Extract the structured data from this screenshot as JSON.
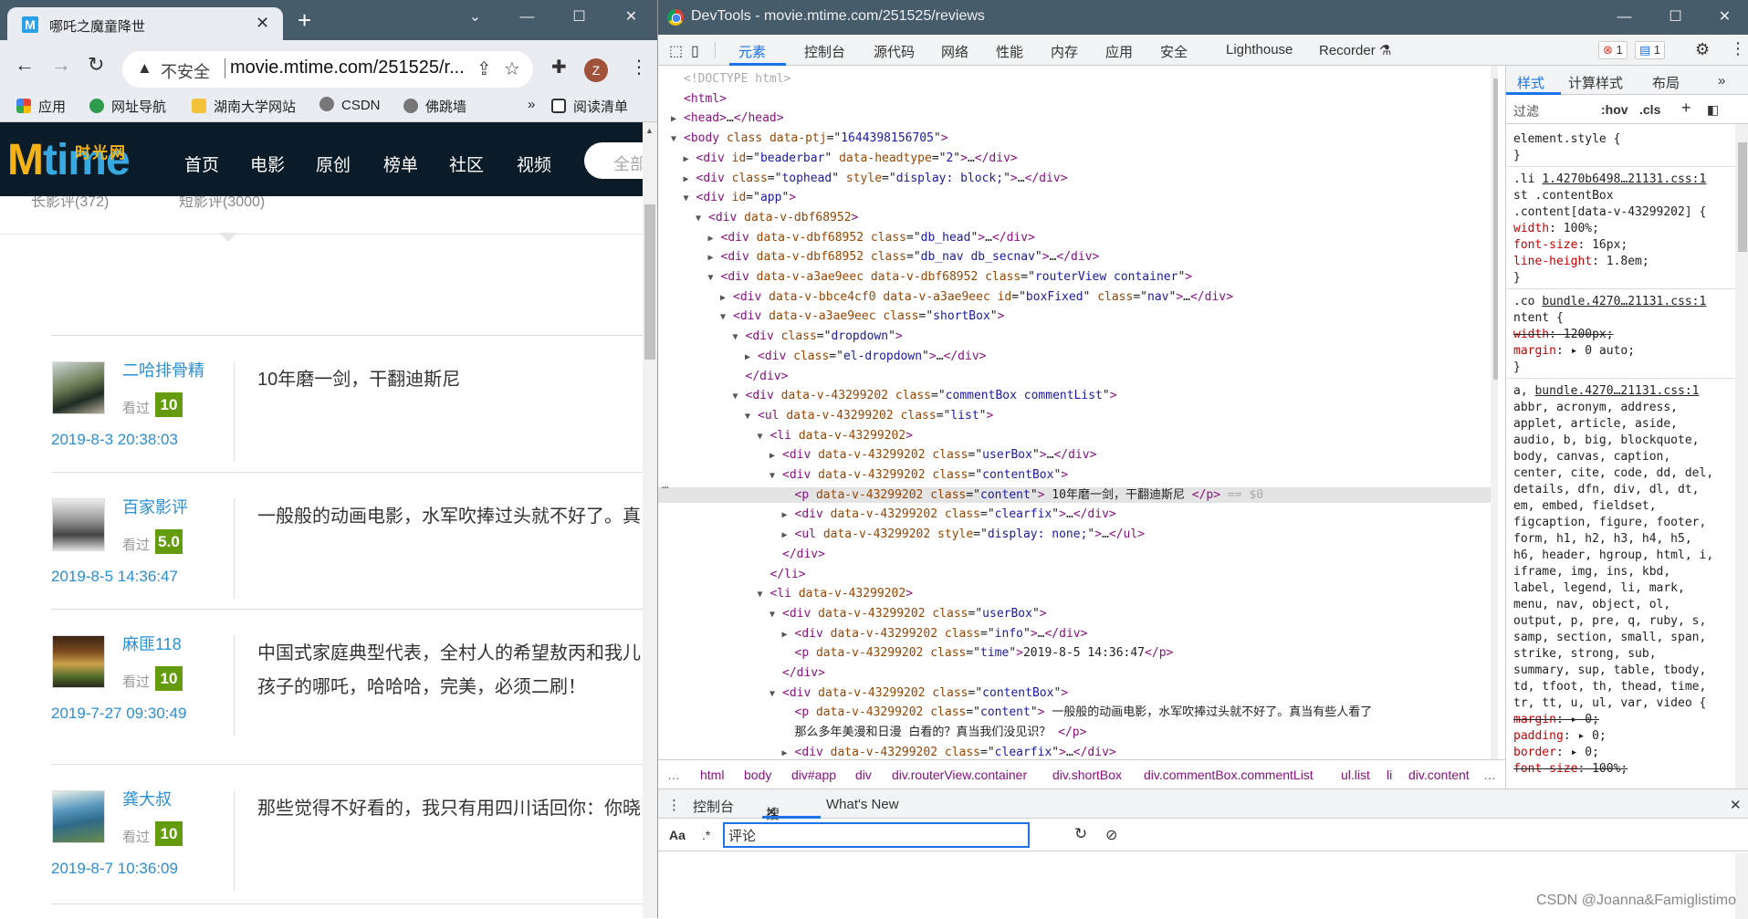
{
  "browser": {
    "tab_title": "哪吒之魔童降世",
    "favicon_letter": "M",
    "insecure_label": "不安全",
    "url": "movie.mtime.com/251525/r...",
    "profile_initial": "Z",
    "bookmarks": [
      "应用",
      "网址导航",
      "湖南大学网站",
      "CSDN",
      "佛跳墙",
      "阅读清单"
    ],
    "more_bookmarks": "»"
  },
  "site": {
    "logo_text": "Mtime",
    "logo_sub": "时光网",
    "nav": [
      "首页",
      "电影",
      "原创",
      "榜单",
      "社区",
      "视频"
    ],
    "search_placeholder": "全部",
    "subtabs": [
      "长影评(372)",
      "短影评(3000)"
    ],
    "reviews": [
      {
        "user": "二哈排骨精",
        "seen_label": "看过",
        "score": "10",
        "date": "2019-8-3 20:38:03",
        "content": "10年磨一剑，干翻迪斯尼",
        "content2": ""
      },
      {
        "user": "百家影评",
        "seen_label": "看过",
        "score": "5.0",
        "date": "2019-8-5 14:36:47",
        "content": "一般般的动画电影，水军吹捧过头就不好了。真",
        "content2": ""
      },
      {
        "user": "麻匪118",
        "seen_label": "看过",
        "score": "10",
        "date": "2019-7-27 09:30:49",
        "content": "中国式家庭典型代表，全村人的希望敖丙和我儿",
        "content2": "孩子的哪吒，哈哈哈，完美，必须二刷！"
      },
      {
        "user": "龚大叔",
        "seen_label": "看过",
        "score": "10",
        "date": "2019-8-7 10:36:09",
        "content": "那些觉得不好看的，我只有用四川话回你：你晓",
        "content2": ""
      }
    ]
  },
  "devtools": {
    "title": "DevTools - movie.mtime.com/251525/reviews",
    "tabs": [
      "元素",
      "控制台",
      "源代码",
      "网络",
      "性能",
      "内存",
      "应用",
      "安全",
      "Lighthouse",
      "Recorder"
    ],
    "error_count": "1",
    "message_count": "1",
    "dom_lines": [
      {
        "d": 0,
        "t": "",
        "h": "<span class='cm'>&lt;!DOCTYPE html&gt;</span>"
      },
      {
        "d": 0,
        "t": "",
        "h": "<span class='tag'>&lt;html&gt;</span>"
      },
      {
        "d": 0,
        "t": "▶",
        "h": "<span class='tag'>&lt;head&gt;</span>…<span class='tag'>&lt;/head&gt;</span>"
      },
      {
        "d": 0,
        "t": "▼",
        "h": "<span class='tag'>&lt;body </span><span class='an'>class</span> <span class='an'>data-ptj</span>=\"<span class='av2'>1644398156705</span>\"<span class='tag'>&gt;</span>"
      },
      {
        "d": 1,
        "t": "▶",
        "h": "<span class='tag'>&lt;div </span><span class='an'>id</span>=\"<span class='av2'>beaderbar</span>\" <span class='an'>data-headtype</span>=\"<span class='av2'>2</span>\"<span class='tag'>&gt;</span>…<span class='tag'>&lt;/div&gt;</span>"
      },
      {
        "d": 1,
        "t": "▶",
        "h": "<span class='tag'>&lt;div </span><span class='an'>class</span>=\"<span class='av2'>tophead</span>\" <span class='an'>style</span>=\"<span class='av2'>display: block;</span>\"<span class='tag'>&gt;</span>…<span class='tag'>&lt;/div&gt;</span>"
      },
      {
        "d": 1,
        "t": "▼",
        "h": "<span class='tag'>&lt;div </span><span class='an'>id</span>=\"<span class='av2'>app</span>\"<span class='tag'>&gt;</span>"
      },
      {
        "d": 2,
        "t": "▼",
        "h": "<span class='tag'>&lt;div </span><span class='an'>data-v-dbf68952</span><span class='tag'>&gt;</span>"
      },
      {
        "d": 3,
        "t": "▶",
        "h": "<span class='tag'>&lt;div </span><span class='an'>data-v-dbf68952</span> <span class='an'>class</span>=\"<span class='av2'>db_head</span>\"<span class='tag'>&gt;</span>…<span class='tag'>&lt;/div&gt;</span>"
      },
      {
        "d": 3,
        "t": "▶",
        "h": "<span class='tag'>&lt;div </span><span class='an'>data-v-dbf68952</span> <span class='an'>class</span>=\"<span class='av2'>db_nav db_secnav</span>\"<span class='tag'>&gt;</span>…<span class='tag'>&lt;/div&gt;</span>"
      },
      {
        "d": 3,
        "t": "▼",
        "h": "<span class='tag'>&lt;div </span><span class='an'>data-v-a3ae9eec</span> <span class='an'>data-v-dbf68952</span> <span class='an'>class</span>=\"<span class='av2'>routerView container</span>\"<span class='tag'>&gt;</span>"
      },
      {
        "d": 4,
        "t": "▶",
        "h": "<span class='tag'>&lt;div </span><span class='an'>data-v-bbce4cf0</span> <span class='an'>data-v-a3ae9eec</span> <span class='an'>id</span>=\"<span class='av2'>boxFixed</span>\" <span class='an'>class</span>=\"<span class='av2'>nav</span>\"<span class='tag'>&gt;</span>…<span class='tag'>&lt;/div&gt;</span>"
      },
      {
        "d": 4,
        "t": "▼",
        "h": "<span class='tag'>&lt;div </span><span class='an'>data-v-a3ae9eec</span> <span class='an'>class</span>=\"<span class='av2'>shortBox</span>\"<span class='tag'>&gt;</span>"
      },
      {
        "d": 5,
        "t": "▼",
        "h": "<span class='tag'>&lt;div </span><span class='an'>class</span>=\"<span class='av2'>dropdown</span>\"<span class='tag'>&gt;</span>"
      },
      {
        "d": 6,
        "t": "▶",
        "h": "<span class='tag'>&lt;div </span><span class='an'>class</span>=\"<span class='av2'>el-dropdown</span>\"<span class='tag'>&gt;</span>…<span class='tag'>&lt;/div&gt;</span>"
      },
      {
        "d": 5,
        "t": "",
        "h": "<span class='tag'>&lt;/div&gt;</span>"
      },
      {
        "d": 5,
        "t": "▼",
        "h": "<span class='tag'>&lt;div </span><span class='an'>data-v-43299202</span> <span class='an'>class</span>=\"<span class='av2'>commentBox commentList</span>\"<span class='tag'>&gt;</span>"
      },
      {
        "d": 6,
        "t": "▼",
        "h": "<span class='tag'>&lt;ul </span><span class='an'>data-v-43299202</span> <span class='an'>class</span>=\"<span class='av2'>list</span>\"<span class='tag'>&gt;</span>"
      },
      {
        "d": 7,
        "t": "▼",
        "h": "<span class='tag'>&lt;li </span><span class='an'>data-v-43299202</span><span class='tag'>&gt;</span>"
      },
      {
        "d": 8,
        "t": "▶",
        "h": "<span class='tag'>&lt;div </span><span class='an'>data-v-43299202</span> <span class='an'>class</span>=\"<span class='av2'>userBox</span>\"<span class='tag'>&gt;</span>…<span class='tag'>&lt;/div&gt;</span>"
      },
      {
        "d": 8,
        "t": "▼",
        "h": "<span class='tag'>&lt;div </span><span class='an'>data-v-43299202</span> <span class='an'>class</span>=\"<span class='av2'>contentBox</span>\"<span class='tag'>&gt;</span>"
      },
      {
        "d": 9,
        "t": "",
        "sel": true,
        "h": "<span class='tag'>&lt;p </span><span class='an'>data-v-43299202</span> <span class='an'>class</span>=\"<span class='av2'>content</span>\"<span class='tag'>&gt;</span> 10年磨一剑，干翻迪斯尼 <span class='tag'>&lt;/p&gt;</span> <span class='cm'>== $0</span>"
      },
      {
        "d": 9,
        "t": "▶",
        "h": "<span class='tag'>&lt;div </span><span class='an'>data-v-43299202</span> <span class='an'>class</span>=\"<span class='av2'>clearfix</span>\"<span class='tag'>&gt;</span>…<span class='tag'>&lt;/div&gt;</span>"
      },
      {
        "d": 9,
        "t": "▶",
        "h": "<span class='tag'>&lt;ul </span><span class='an'>data-v-43299202</span> <span class='an'>style</span>=\"<span class='av2'>display: none;</span>\"<span class='tag'>&gt;</span>…<span class='tag'>&lt;/ul&gt;</span>"
      },
      {
        "d": 8,
        "t": "",
        "h": "<span class='tag'>&lt;/div&gt;</span>"
      },
      {
        "d": 7,
        "t": "",
        "h": "<span class='tag'>&lt;/li&gt;</span>"
      },
      {
        "d": 7,
        "t": "▼",
        "h": "<span class='tag'>&lt;li </span><span class='an'>data-v-43299202</span><span class='tag'>&gt;</span>"
      },
      {
        "d": 8,
        "t": "▼",
        "h": "<span class='tag'>&lt;div </span><span class='an'>data-v-43299202</span> <span class='an'>class</span>=\"<span class='av2'>userBox</span>\"<span class='tag'>&gt;</span>"
      },
      {
        "d": 9,
        "t": "▶",
        "h": "<span class='tag'>&lt;div </span><span class='an'>data-v-43299202</span> <span class='an'>class</span>=\"<span class='av2'>info</span>\"<span class='tag'>&gt;</span>…<span class='tag'>&lt;/div&gt;</span>"
      },
      {
        "d": 9,
        "t": "",
        "h": "<span class='tag'>&lt;p </span><span class='an'>data-v-43299202</span> <span class='an'>class</span>=\"<span class='av2'>time</span>\"<span class='tag'>&gt;</span>2019-8-5 14:36:47<span class='tag'>&lt;/p&gt;</span>"
      },
      {
        "d": 8,
        "t": "",
        "h": "<span class='tag'>&lt;/div&gt;</span>"
      },
      {
        "d": 8,
        "t": "▼",
        "h": "<span class='tag'>&lt;div </span><span class='an'>data-v-43299202</span> <span class='an'>class</span>=\"<span class='av2'>contentBox</span>\"<span class='tag'>&gt;</span>"
      },
      {
        "d": 9,
        "t": "",
        "h": "<span class='tag'>&lt;p </span><span class='an'>data-v-43299202</span> <span class='an'>class</span>=\"<span class='av2'>content</span>\"<span class='tag'>&gt;</span> 一般般的动画电影，水军吹捧过头就不好了。真当有些人看了"
      },
      {
        "d": 9,
        "t": "",
        "h": "那么多年美漫和日漫 白看的？真当我们没见识？ <span class='tag'>&lt;/p&gt;</span>"
      },
      {
        "d": 9,
        "t": "▶",
        "h": "<span class='tag'>&lt;div </span><span class='an'>data-v-43299202</span> <span class='an'>class</span>=\"<span class='av2'>clearfix</span>\"<span class='tag'>&gt;</span>…<span class='tag'>&lt;/div&gt;</span>"
      }
    ],
    "breadcrumbs": [
      "…",
      "html",
      "body",
      "div#app",
      "div",
      "div.routerView.container",
      "div.shortBox",
      "div.commentBox.commentList",
      "ul.list",
      "li",
      "div.content",
      "…"
    ],
    "styles_tabs": [
      "样式",
      "计算样式",
      "布局",
      "»"
    ],
    "filter_placeholder": "过滤",
    "hov": ":hov",
    "cls": ".cls",
    "plus": "+",
    "style_lines": [
      {
        "h": "element.style {"
      },
      {
        "h": "}"
      },
      {
        "hr": true
      },
      {
        "h": ".li  <span class='src'>1.4270b6498…21131.css:1</span>"
      },
      {
        "h": "st .contentBox"
      },
      {
        "h": ".content[data-v-43299202] {"
      },
      {
        "h": "  <span class='pn'>width</span>: 100%;"
      },
      {
        "h": "  <span class='pn'>font-size</span>: 16px;"
      },
      {
        "h": "  <span class='pn'>line-height</span>: 1.8em;"
      },
      {
        "h": "}"
      },
      {
        "hr": true
      },
      {
        "h": ".co    <span class='src'>bundle.4270…21131.css:1</span>"
      },
      {
        "h": "ntent {"
      },
      {
        "h": "  <span class='strike'><span class='pn'>width</span>: 1200px;</span>"
      },
      {
        "h": "  <span class='pn'>margin</span>: ▸ 0 auto;"
      },
      {
        "h": "}"
      },
      {
        "hr": true
      },
      {
        "h": "a,     <span class='src'>bundle.4270…21131.css:1</span>"
      },
      {
        "h": "abbr, acronym, address,"
      },
      {
        "h": "applet, article, aside,"
      },
      {
        "h": "audio, b, big, blockquote,"
      },
      {
        "h": "body, canvas, caption,"
      },
      {
        "h": "center, cite, code, dd, del,"
      },
      {
        "h": "details, dfn, div, dl, dt,"
      },
      {
        "h": "em, embed, fieldset,"
      },
      {
        "h": "figcaption, figure, footer,"
      },
      {
        "h": "form, h1, h2, h3, h4, h5,"
      },
      {
        "h": "h6, header, hgroup, html, i,"
      },
      {
        "h": "iframe, img, ins, kbd,"
      },
      {
        "h": "label, legend, li, mark,"
      },
      {
        "h": "menu, nav, object, ol,"
      },
      {
        "h": "output, p, pre, q, ruby, s,"
      },
      {
        "h": "samp, section, small, span,"
      },
      {
        "h": "strike, strong, sub,"
      },
      {
        "h": "summary, sup, table, tbody,"
      },
      {
        "h": "td, tfoot, th, thead, time,"
      },
      {
        "h": "tr, tt, u, ul, var, video {"
      },
      {
        "h": "  <span class='strike'><span class='pn'>margin</span>: ▸ 0;</span>"
      },
      {
        "h": "  <span class='pn'>padding</span>: ▸ 0;"
      },
      {
        "h": "  <span class='pn'>border</span>: ▸ 0;"
      },
      {
        "h": "  <span class='strike'><span class='pn'>font-size</span>: 100%;</span>"
      }
    ],
    "drawer_tabs": [
      "控制台",
      "搜索",
      "What's New"
    ],
    "search_aa": "Aa",
    "search_regex": ".*",
    "search_value": "评论"
  },
  "watermark": "CSDN @Joanna&Famiglistimo"
}
